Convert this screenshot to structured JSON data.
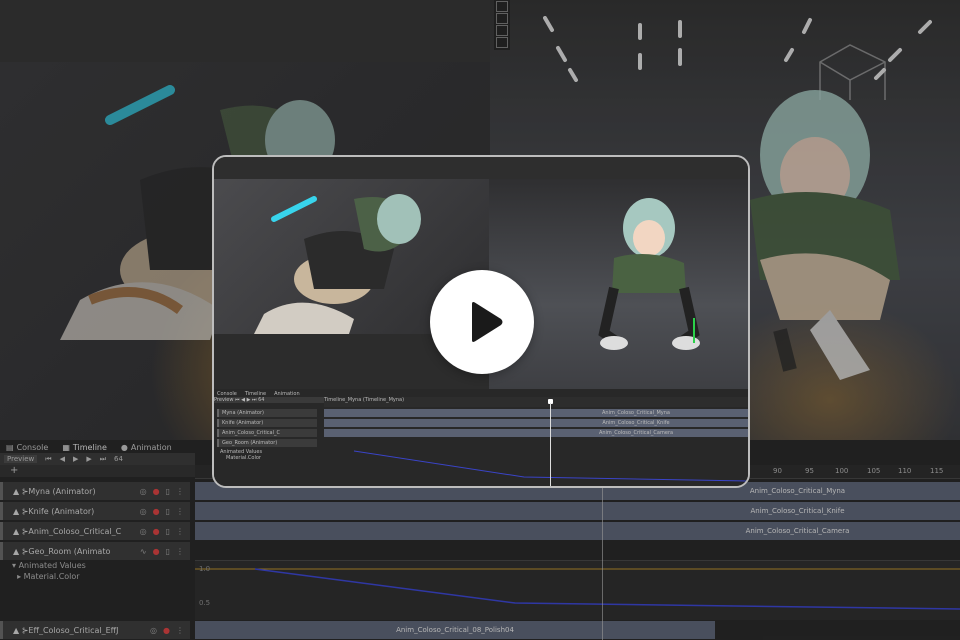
{
  "editor": {
    "tabs": [
      {
        "label": "Console",
        "icon": "console-icon"
      },
      {
        "label": "Timeline",
        "icon": "timeline-icon"
      },
      {
        "label": "Animation",
        "icon": "animation-icon"
      }
    ],
    "preview_label": "Preview",
    "frame_value": "64",
    "ruler_ticks_right": [
      "90",
      "95",
      "100",
      "105",
      "110",
      "115"
    ],
    "tracks": [
      {
        "label": "Myna (Animator)"
      },
      {
        "label": "Knife (Animator)"
      },
      {
        "label": "Anim_Coloso_Critical_C"
      },
      {
        "label": "Geo_Room (Animato"
      }
    ],
    "clips": [
      "Anim_Coloso_Critical_Myna",
      "Anim_Coloso_Critical_Knife",
      "Anim_Coloso_Critical_Camera"
    ],
    "animated_values_label": "Animated Values",
    "material_color_label": "Material.Color",
    "bottom_track_label": "Eff_Coloso_Critical_EffJ",
    "bottom_clip_label": "Anim_Coloso_Critical_08_Polish04",
    "curve_values": [
      "1.0",
      "0.5"
    ]
  },
  "card": {
    "tabs": [
      "Console",
      "Timeline",
      "Animation"
    ],
    "preview_label": "Preview",
    "frame_value": "64",
    "timeline_asset": "Timeline_Myna (Timeline_Myna)",
    "tracks": [
      "Myna (Animator)",
      "Knife (Animator)",
      "Anim_Coloso_Critical_C",
      "Geo_Room (Animator)"
    ],
    "clips": [
      "Anim_Coloso_Critical_Myna",
      "Anim_Coloso_Critical_Knife",
      "Anim_Coloso_Critical_Camera"
    ],
    "animated_values_label": "Animated Values",
    "material_color_label": "Material.Color"
  },
  "play_button": {
    "icon": "play-icon"
  },
  "colors": {
    "accent_glow": "#d79632",
    "clip": "#5a6172",
    "record": "#d04040"
  }
}
